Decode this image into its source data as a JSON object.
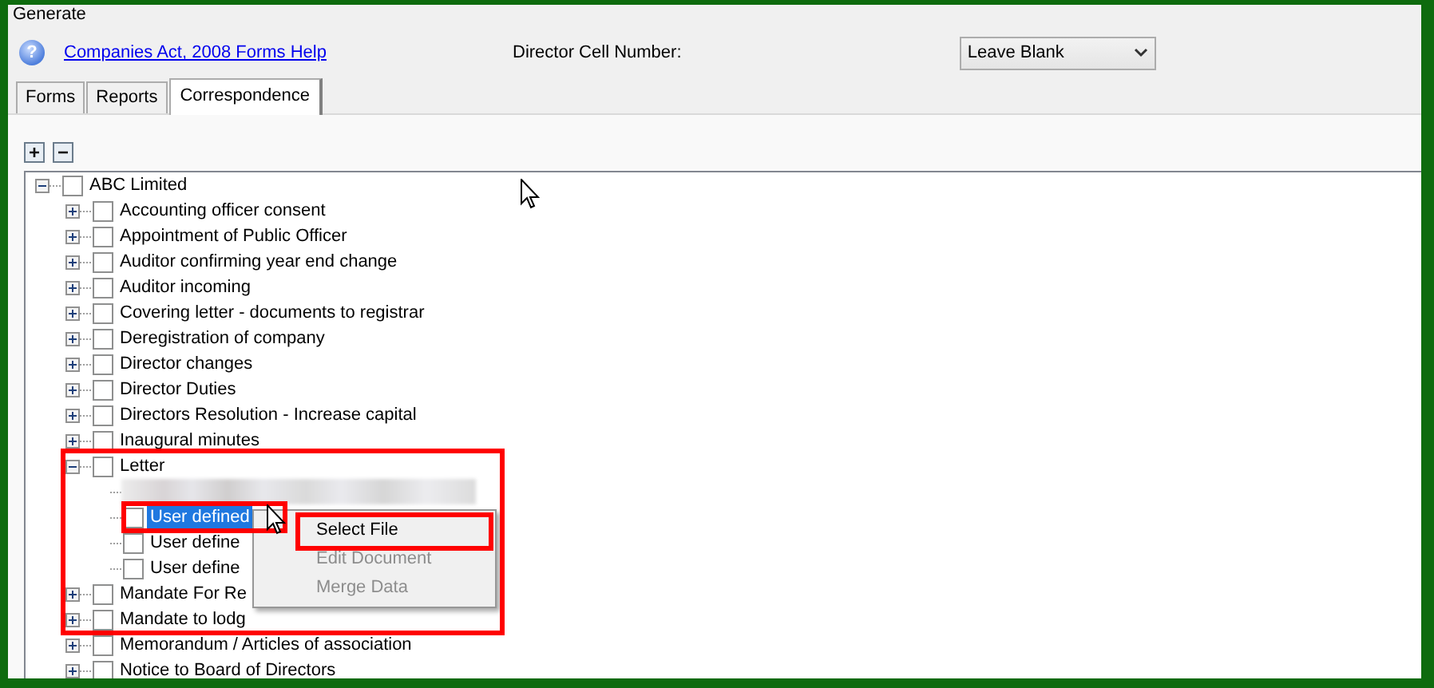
{
  "header": {
    "title": "Generate"
  },
  "help": {
    "icon": "?",
    "link": "Companies Act, 2008 Forms Help"
  },
  "director_cell_number": {
    "label": "Director Cell Number:",
    "value": "Leave Blank"
  },
  "tabs": [
    {
      "label": "Forms",
      "selected": false
    },
    {
      "label": "Reports",
      "selected": false
    },
    {
      "label": "Correspondence",
      "selected": true
    }
  ],
  "tree": [
    {
      "kind": "item",
      "label": "ABC Limited",
      "checked": false,
      "expanded": true,
      "selected": false,
      "children": [
        {
          "kind": "item",
          "label": "Accounting officer consent",
          "checked": false,
          "expanded": false,
          "selected": false
        },
        {
          "kind": "item",
          "label": "Appointment of Public Officer",
          "checked": false,
          "expanded": false,
          "selected": false
        },
        {
          "kind": "item",
          "label": "Auditor confirming year end change",
          "checked": false,
          "expanded": false,
          "selected": false
        },
        {
          "kind": "item",
          "label": "Auditor incoming",
          "checked": false,
          "expanded": false,
          "selected": false
        },
        {
          "kind": "item",
          "label": "Covering letter - documents to registrar",
          "checked": false,
          "expanded": false,
          "selected": false
        },
        {
          "kind": "item",
          "label": "Deregistration of company",
          "checked": false,
          "expanded": false,
          "selected": false
        },
        {
          "kind": "item",
          "label": "Director changes",
          "checked": false,
          "expanded": false,
          "selected": false
        },
        {
          "kind": "item",
          "label": "Director Duties",
          "checked": false,
          "expanded": false,
          "selected": false
        },
        {
          "kind": "item",
          "label": "Directors Resolution - Increase capital",
          "checked": false,
          "expanded": false,
          "selected": false
        },
        {
          "kind": "item",
          "label": "Inaugural minutes",
          "checked": false,
          "expanded": false,
          "selected": false
        },
        {
          "kind": "item",
          "label": "Letter",
          "checked": false,
          "expanded": true,
          "selected": false,
          "children": [
            {
              "kind": "redacted"
            },
            {
              "kind": "item",
              "label": "User defined",
              "checked": false,
              "selected": true
            },
            {
              "kind": "item",
              "label": "User define",
              "checked": false,
              "selected": false
            },
            {
              "kind": "item",
              "label": "User define",
              "checked": false,
              "selected": false
            }
          ]
        },
        {
          "kind": "item",
          "label": "Mandate For Re",
          "checked": false,
          "expanded": false,
          "selected": false
        },
        {
          "kind": "item",
          "label": "Mandate to lodg",
          "checked": false,
          "expanded": false,
          "selected": false
        },
        {
          "kind": "item",
          "label": "Memorandum / Articles of association",
          "checked": false,
          "expanded": false,
          "selected": false
        },
        {
          "kind": "item",
          "label": "Notice to Board of Directors",
          "checked": false,
          "expanded": false,
          "selected": false
        }
      ]
    }
  ],
  "context_menu": {
    "items": [
      {
        "label": "Select File",
        "disabled": false
      },
      {
        "label": "Edit Document",
        "disabled": true
      },
      {
        "label": "Merge Data",
        "disabled": true
      }
    ]
  }
}
